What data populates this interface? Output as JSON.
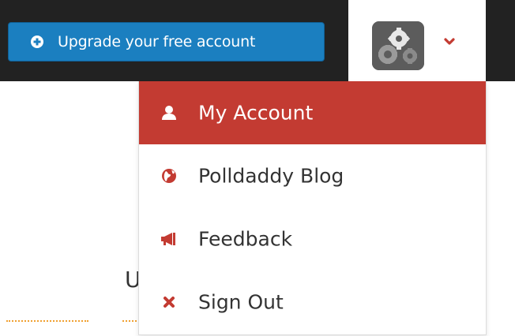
{
  "header": {
    "upgrade_button": {
      "label": "Upgrade your free account",
      "icon": "plus-circle-icon"
    },
    "user_menu": {
      "avatar_icon": "gear-avatar-icon",
      "toggle_icon": "chevron-down-icon"
    }
  },
  "dropdown": {
    "items": [
      {
        "label": "My Account",
        "icon": "user-icon",
        "active": true
      },
      {
        "label": "Polldaddy Blog",
        "icon": "globe-icon",
        "active": false
      },
      {
        "label": "Feedback",
        "icon": "megaphone-icon",
        "active": false
      },
      {
        "label": "Sign Out",
        "icon": "close-x-icon",
        "active": false
      }
    ]
  },
  "background": {
    "partial_heading": "U"
  },
  "colors": {
    "topbar": "#222222",
    "primary_button": "#1b7fc0",
    "accent": "#c33b32",
    "dotted_line": "#f0a030"
  }
}
